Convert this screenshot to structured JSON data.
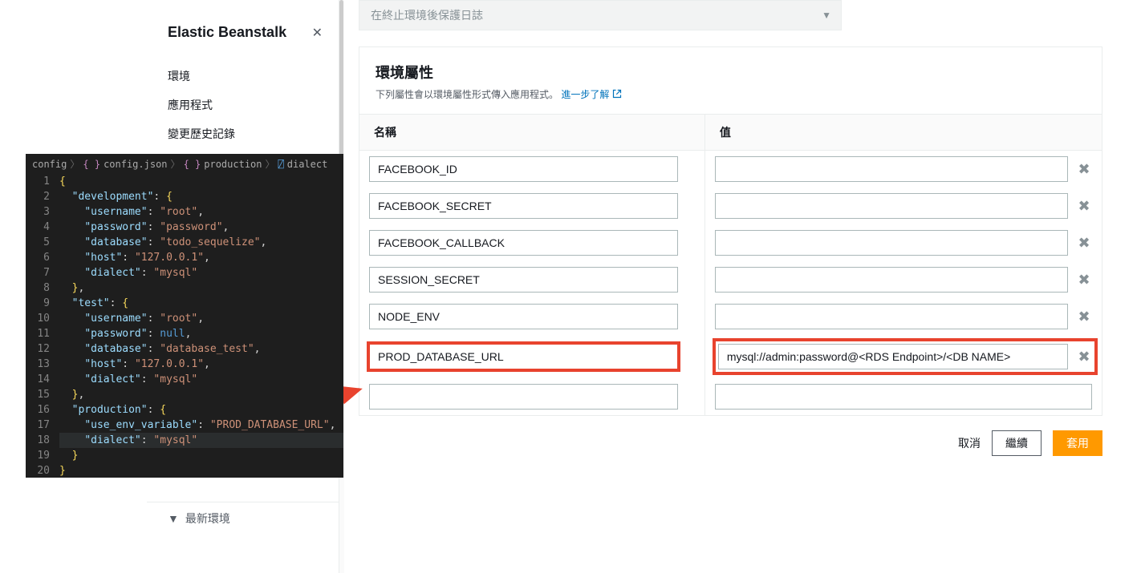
{
  "sidebar": {
    "title": "Elastic Beanstalk",
    "nav": [
      {
        "label": "環境"
      },
      {
        "label": "應用程式"
      },
      {
        "label": "變更歷史記錄"
      }
    ],
    "recent": "最新環境"
  },
  "collapsedSection": "在終止環境後保護日誌",
  "panel": {
    "title": "環境屬性",
    "desc_prefix": "下列屬性會以環境屬性形式傳入應用程式。",
    "link_text": "進一步了解"
  },
  "table": {
    "headers": {
      "name": "名稱",
      "value": "值"
    },
    "rows": [
      {
        "name": "FACEBOOK_ID",
        "value": "",
        "highlight": false
      },
      {
        "name": "FACEBOOK_SECRET",
        "value": "",
        "highlight": false
      },
      {
        "name": "FACEBOOK_CALLBACK",
        "value": "",
        "highlight": false
      },
      {
        "name": "SESSION_SECRET",
        "value": "",
        "highlight": false
      },
      {
        "name": "NODE_ENV",
        "value": "",
        "highlight": false
      },
      {
        "name": "PROD_DATABASE_URL",
        "value": "mysql://admin:password@<RDS Endpoint>/<DB NAME>",
        "highlight": true
      },
      {
        "name": "",
        "value": "",
        "highlight": false,
        "empty": true
      }
    ]
  },
  "buttons": {
    "cancel": "取消",
    "continue": "繼續",
    "apply": "套用"
  },
  "editor": {
    "crumbs": [
      "config",
      "config.json",
      "production",
      "dialect"
    ],
    "lines": [
      [
        [
          "y",
          "{"
        ]
      ],
      [
        [
          "p",
          "  "
        ],
        [
          "k",
          "\"development\""
        ],
        [
          "p",
          ": "
        ],
        [
          "y",
          "{"
        ]
      ],
      [
        [
          "p",
          "    "
        ],
        [
          "k",
          "\"username\""
        ],
        [
          "p",
          ": "
        ],
        [
          "s",
          "\"root\""
        ],
        [
          "p",
          ","
        ]
      ],
      [
        [
          "p",
          "    "
        ],
        [
          "k",
          "\"password\""
        ],
        [
          "p",
          ": "
        ],
        [
          "s",
          "\"password\""
        ],
        [
          "p",
          ","
        ]
      ],
      [
        [
          "p",
          "    "
        ],
        [
          "k",
          "\"database\""
        ],
        [
          "p",
          ": "
        ],
        [
          "s",
          "\"todo_sequelize\""
        ],
        [
          "p",
          ","
        ]
      ],
      [
        [
          "p",
          "    "
        ],
        [
          "k",
          "\"host\""
        ],
        [
          "p",
          ": "
        ],
        [
          "s",
          "\"127.0.0.1\""
        ],
        [
          "p",
          ","
        ]
      ],
      [
        [
          "p",
          "    "
        ],
        [
          "k",
          "\"dialect\""
        ],
        [
          "p",
          ": "
        ],
        [
          "s",
          "\"mysql\""
        ]
      ],
      [
        [
          "p",
          "  "
        ],
        [
          "y",
          "}"
        ],
        [
          "p",
          ","
        ]
      ],
      [
        [
          "p",
          "  "
        ],
        [
          "k",
          "\"test\""
        ],
        [
          "p",
          ": "
        ],
        [
          "y",
          "{"
        ]
      ],
      [
        [
          "p",
          "    "
        ],
        [
          "k",
          "\"username\""
        ],
        [
          "p",
          ": "
        ],
        [
          "s",
          "\"root\""
        ],
        [
          "p",
          ","
        ]
      ],
      [
        [
          "p",
          "    "
        ],
        [
          "k",
          "\"password\""
        ],
        [
          "p",
          ": "
        ],
        [
          "n",
          "null"
        ],
        [
          "p",
          ","
        ]
      ],
      [
        [
          "p",
          "    "
        ],
        [
          "k",
          "\"database\""
        ],
        [
          "p",
          ": "
        ],
        [
          "s",
          "\"database_test\""
        ],
        [
          "p",
          ","
        ]
      ],
      [
        [
          "p",
          "    "
        ],
        [
          "k",
          "\"host\""
        ],
        [
          "p",
          ": "
        ],
        [
          "s",
          "\"127.0.0.1\""
        ],
        [
          "p",
          ","
        ]
      ],
      [
        [
          "p",
          "    "
        ],
        [
          "k",
          "\"dialect\""
        ],
        [
          "p",
          ": "
        ],
        [
          "s",
          "\"mysql\""
        ]
      ],
      [
        [
          "p",
          "  "
        ],
        [
          "y",
          "}"
        ],
        [
          "p",
          ","
        ]
      ],
      [
        [
          "p",
          "  "
        ],
        [
          "k",
          "\"production\""
        ],
        [
          "p",
          ": "
        ],
        [
          "y",
          "{"
        ]
      ],
      [
        [
          "p",
          "    "
        ],
        [
          "k",
          "\"use_env_variable\""
        ],
        [
          "p",
          ": "
        ],
        [
          "s",
          "\"PROD_DATABASE_URL\""
        ],
        [
          "p",
          ","
        ]
      ],
      [
        [
          "p",
          "    "
        ],
        [
          "k",
          "\"dialect\""
        ],
        [
          "p",
          ": "
        ],
        [
          "s",
          "\"mysql\""
        ]
      ],
      [
        [
          "p",
          "  "
        ],
        [
          "y",
          "}"
        ]
      ],
      [
        [
          "y",
          "}"
        ]
      ],
      []
    ]
  }
}
